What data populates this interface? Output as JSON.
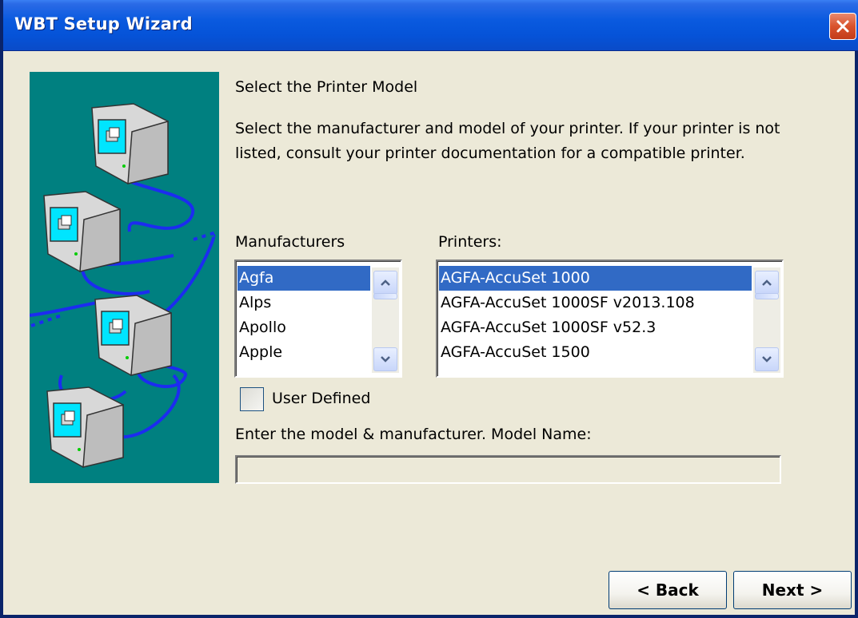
{
  "window": {
    "title": "WBT Setup Wizard"
  },
  "page": {
    "heading": "Select the Printer Model",
    "description": "Select the manufacturer and model of your printer. If your printer is not listed, consult your printer documentation for a compatible printer."
  },
  "manufacturers": {
    "label": "Manufacturers",
    "items": [
      "Agfa",
      "Alps",
      "Apollo",
      "Apple"
    ],
    "selected": "Agfa"
  },
  "printers": {
    "label": "Printers:",
    "items": [
      "AGFA-AccuSet 1000",
      "AGFA-AccuSet 1000SF v2013.108",
      "AGFA-AccuSet 1000SF v52.3",
      "AGFA-AccuSet 1500"
    ],
    "selected": "AGFA-AccuSet 1000"
  },
  "user_defined": {
    "label": "User Defined",
    "checked": false
  },
  "model_name": {
    "label": "Enter the model & manufacturer. Model Name:",
    "value": ""
  },
  "buttons": {
    "back": "< Back",
    "next": "Next >"
  },
  "icons": {
    "close": "close-icon",
    "scroll_up": "chevron-up-icon",
    "scroll_down": "chevron-down-icon",
    "illustration": "networked-computers-illustration"
  },
  "colors": {
    "titlebar": "#0553d8",
    "selection": "#316ac5",
    "panel": "#008080",
    "window_bg": "#ece9d8"
  }
}
